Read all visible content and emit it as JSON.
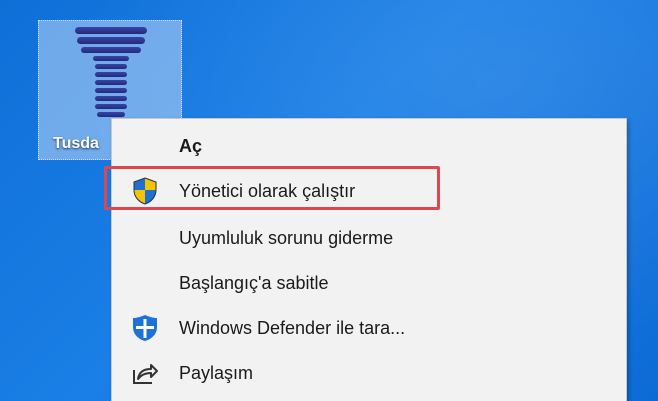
{
  "desktop": {
    "shortcut": {
      "label": "Tusda",
      "icon": "tusdata-app-icon"
    }
  },
  "context_menu": {
    "items": [
      {
        "label": "Aç",
        "icon": "",
        "bold": true
      },
      {
        "label": "Yönetici olarak çalıştır",
        "icon": "uac-shield-icon"
      },
      {
        "label": "Uyumluluk sorunu giderme",
        "icon": ""
      },
      {
        "label": "Başlangıç'a sabitle",
        "icon": ""
      },
      {
        "label": "Windows Defender ile tara...",
        "icon": "windows-defender-icon"
      },
      {
        "label": "Paylaşım",
        "icon": "share-icon"
      }
    ],
    "highlighted_item": "Yönetici olarak çalıştır"
  },
  "colors": {
    "desktop_background": "#1a7fe6",
    "menu_background": "#f2f2f2",
    "highlight_border": "#e0464e",
    "shield_blue": "#1f6fd1",
    "shield_yellow": "#f5c400",
    "app_icon_navy": "#2d3592"
  }
}
